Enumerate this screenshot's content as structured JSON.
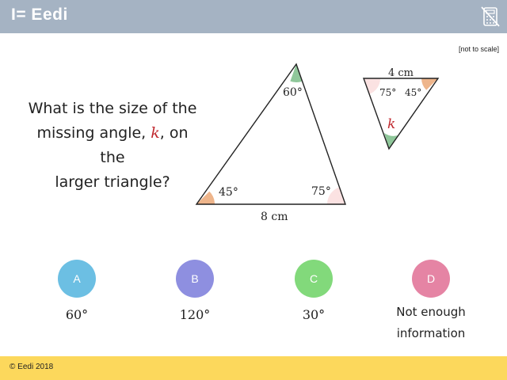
{
  "header": {
    "logo_text": "I= Eedi",
    "calculator_icon": "calculator-crossed-out-icon",
    "background": "#a5b3c3"
  },
  "note": "[not to scale]",
  "question": {
    "line1": "What is the size of the",
    "line2_prefix": "missing angle, ",
    "variable": "k",
    "line2_suffix": ", on the",
    "line3": "larger triangle?"
  },
  "diagram": {
    "large_triangle": {
      "top_angle": "60°",
      "left_angle": "45°",
      "right_angle": "75°",
      "base": "8 cm"
    },
    "small_triangle": {
      "top_side": "4 cm",
      "left_angle": "75°",
      "right_angle": "45°",
      "bottom_angle": "k"
    },
    "angle_colors": {
      "green": "#8fc79a",
      "orange": "#eeb58b",
      "pink": "#fbe2e2"
    }
  },
  "options": [
    {
      "letter": "A",
      "answer": "60°",
      "color": "#6cbfe3"
    },
    {
      "letter": "B",
      "answer": "120°",
      "color": "#8e8fe0"
    },
    {
      "letter": "C",
      "answer": "30°",
      "color": "#82d97b"
    },
    {
      "letter": "D",
      "answer_line1": "Not enough",
      "answer_line2": "information",
      "color": "#e584a4"
    }
  ],
  "footer": {
    "copyright": "© Eedi 2018",
    "background": "#fcd85c"
  }
}
